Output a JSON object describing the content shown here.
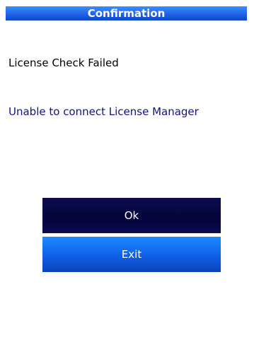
{
  "dialog": {
    "title": "Confirmation",
    "status_text": "License Check Failed",
    "message_text": "Unable to connect License Manager"
  },
  "buttons": {
    "ok_label": "Ok",
    "exit_label": "Exit"
  },
  "colors": {
    "title_bar": "#1f62e6",
    "message_text": "#12128a",
    "ok_button": "#05053a",
    "exit_button": "#0f5fe6"
  }
}
